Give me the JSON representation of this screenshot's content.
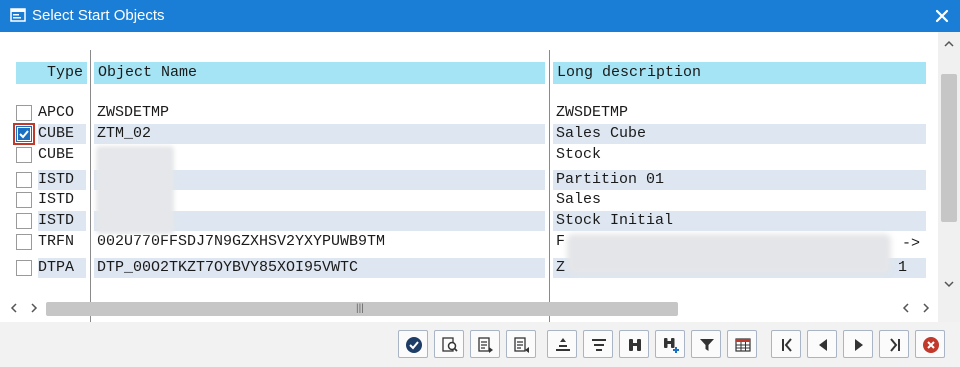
{
  "window": {
    "title": "Select Start Objects"
  },
  "columns": {
    "type": "Type",
    "name": "Object Name",
    "desc": "Long description"
  },
  "rows": [
    {
      "type": "APCO",
      "name": "ZWSDETMP",
      "desc": "ZWSDETMP",
      "checked": false,
      "alt": false
    },
    {
      "type": "CUBE",
      "name": "ZTM_02",
      "desc": "Sales Cube",
      "checked": true,
      "alt": true
    },
    {
      "type": "CUBE",
      "name": "",
      "desc": "Stock",
      "checked": false,
      "alt": false
    },
    {
      "type": "ISTD",
      "name": "",
      "desc": "Partition 01",
      "checked": false,
      "alt": true
    },
    {
      "type": "ISTD",
      "name": "",
      "desc": "Sales",
      "checked": false,
      "alt": false
    },
    {
      "type": "ISTD",
      "name": "",
      "desc": "Stock Initial",
      "checked": false,
      "alt": true
    },
    {
      "type": "TRFN",
      "name": "002U770FFSDJ7N9GZXHSV2YXYPUWB9TM",
      "desc": "F",
      "checked": false,
      "alt": false
    },
    {
      "type": "DTPA",
      "name": "DTP_00O2TKZT7OYBVY85XOI95VWTC",
      "desc": "Z",
      "checked": false,
      "alt": true
    }
  ],
  "overflow_marker": "->",
  "row8_desc_tail": "1",
  "toolbar": [
    "confirm-icon",
    "find-icon",
    "find-next-icon",
    "find-previous-icon",
    "sort-ascending-icon",
    "sort-descending-icon",
    "search-binoculars-icon",
    "search-binoculars-plus-icon",
    "filter-icon",
    "table-layout-icon",
    "first-page-icon",
    "previous-page-icon",
    "next-page-icon",
    "last-page-icon",
    "cancel-icon"
  ],
  "colors": {
    "titlebar": "#1a7ed6",
    "header": "#a4e4f4",
    "alt_row": "#dde6f1",
    "cancel": "#c0392b"
  }
}
